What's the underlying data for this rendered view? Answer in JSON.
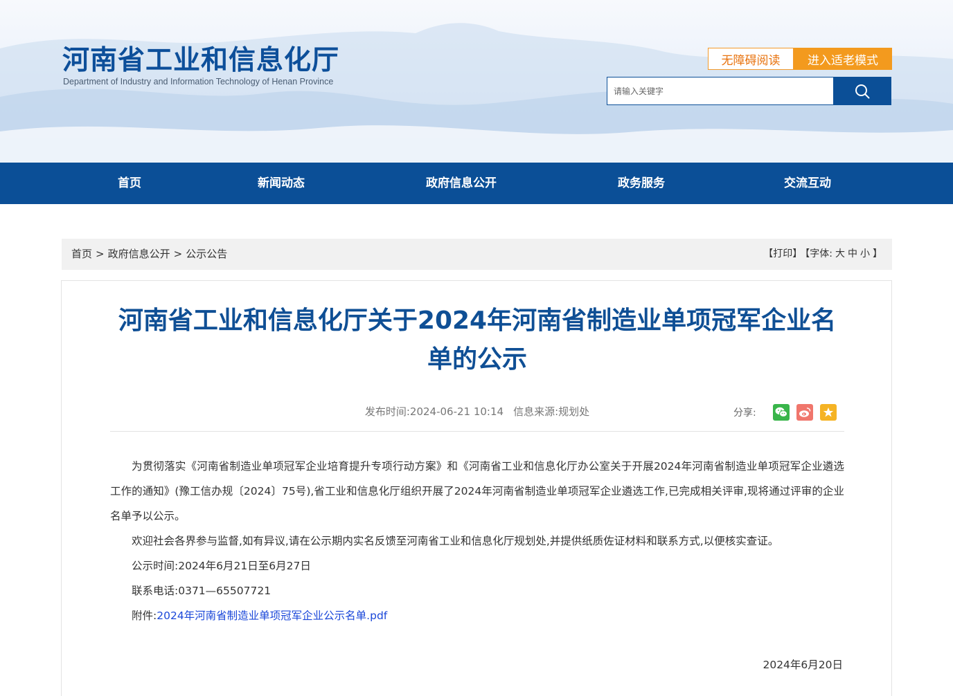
{
  "header": {
    "logo_cn": "河南省工业和信息化厅",
    "logo_en": "Department of Industry and Information Technology of Henan Province",
    "accessible_label": "无障碍阅读",
    "elder_mode_label": "进入适老模式",
    "search_placeholder": "请输入关键字",
    "search_icon": "search-icon"
  },
  "nav": {
    "items": [
      {
        "label": "首页"
      },
      {
        "label": "新闻动态"
      },
      {
        "label": "政府信息公开"
      },
      {
        "label": "政务服务"
      },
      {
        "label": "交流互动"
      }
    ]
  },
  "breadcrumb": {
    "items": [
      "首页",
      "政府信息公开",
      "公示公告"
    ],
    "separator": ">"
  },
  "tools": {
    "print": "【打印】",
    "font_label": "【字体:",
    "font_large": "大",
    "font_medium": "中",
    "font_small": "小",
    "close": "】"
  },
  "article": {
    "title": "河南省工业和信息化厅关于2024年河南省制造业单项冠军企业名单的公示",
    "publish_time_label": "发布时间:",
    "publish_time": "2024-06-21 10:14",
    "source_label": "信息来源:",
    "source": "规划处",
    "share_label": "分享:",
    "share_icons": [
      "wechat-icon",
      "weibo-icon",
      "favorite-icon"
    ],
    "share_colors": {
      "wechat": "#39b54a",
      "weibo": "#f0766c",
      "favorite": "#f5b324"
    },
    "paragraphs": [
      "为贯彻落实《河南省制造业单项冠军企业培育提升专项行动方案》和《河南省工业和信息化厅办公室关于开展2024年河南省制造业单项冠军企业遴选工作的通知》(豫工信办规〔2024〕75号),省工业和信息化厅组织开展了2024年河南省制造业单项冠军企业遴选工作,已完成相关评审,现将通过评审的企业名单予以公示。",
      "欢迎社会各界参与监督,如有异议,请在公示期内实名反馈至河南省工业和信息化厅规划处,并提供纸质佐证材料和联系方式,以便核实查证。",
      "公示时间:2024年6月21日至6月27日",
      "联系电话:0371—65507721"
    ],
    "attachment_label": "附件:",
    "attachment_link": "2024年河南省制造业单项冠军企业公示名单.pdf",
    "sign_date": "2024年6月20日"
  }
}
